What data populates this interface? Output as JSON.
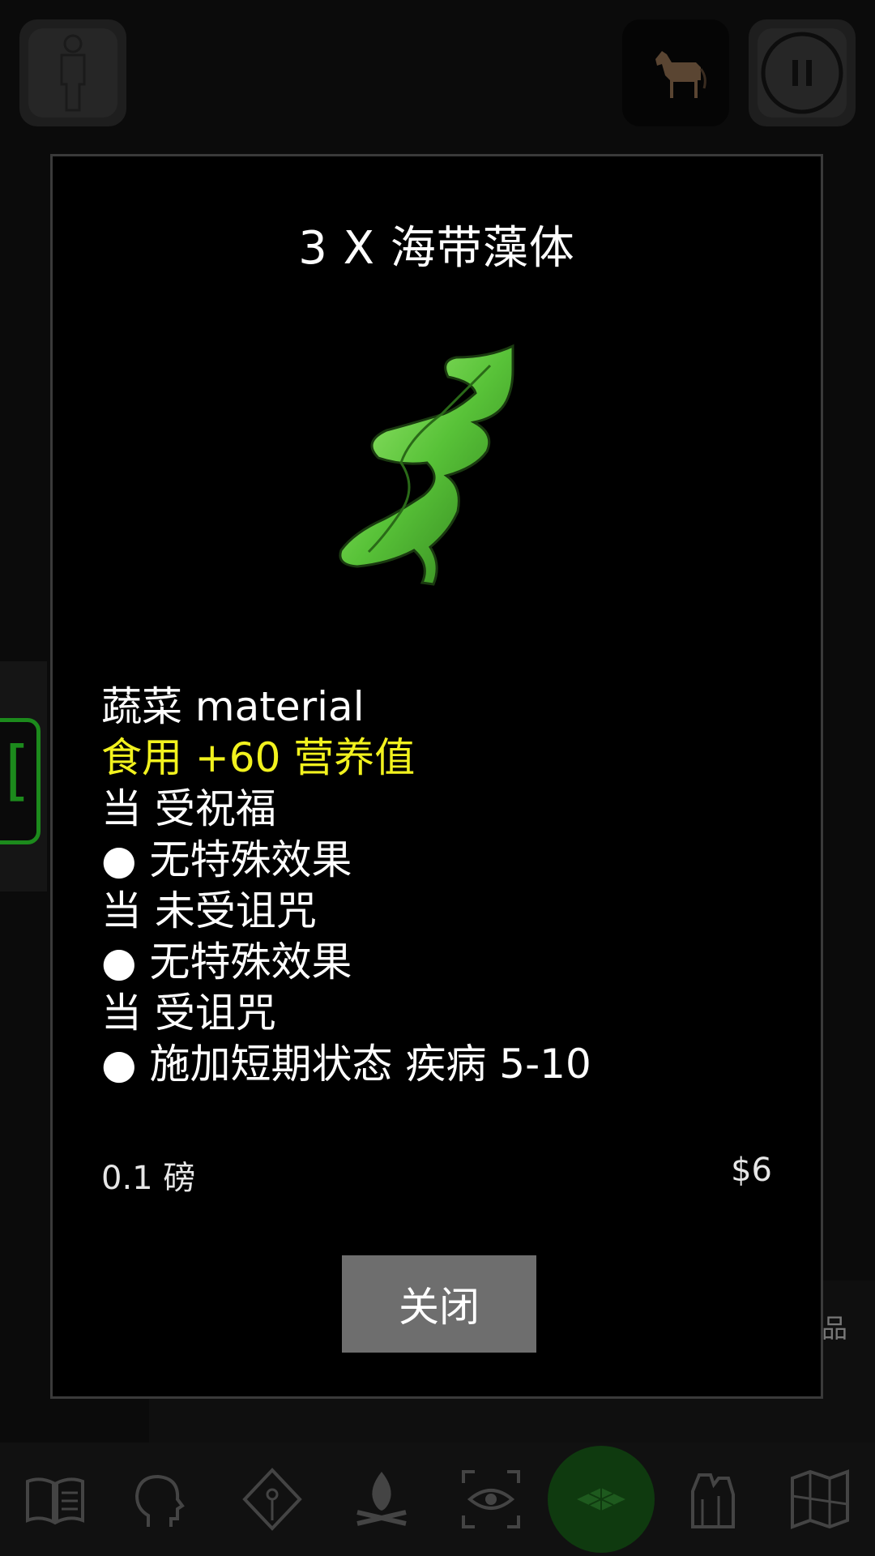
{
  "dialog": {
    "title": "3 X 海带藻体",
    "item_image": "kelp-icon",
    "type_line": "蔬菜 material",
    "food_line": "食用 +60 营养值",
    "effects": [
      "当 受祝福",
      "● 无特殊效果",
      "当 未受诅咒",
      "● 无特殊效果",
      "当 受诅咒",
      "● 施加短期状态 疾病 5-10"
    ],
    "weight": "0.1 磅",
    "price": "$6",
    "close_label": "关闭"
  },
  "background": {
    "right_label_fragment": "品"
  },
  "top_bar": {
    "character_icon": "person-icon",
    "mount_icon": "horse-icon",
    "pause_icon": "pause-icon"
  },
  "bottom_nav": [
    {
      "icon": "journal-icon",
      "active": false
    },
    {
      "icon": "head-icon",
      "active": false
    },
    {
      "icon": "skills-icon",
      "active": false
    },
    {
      "icon": "campfire-icon",
      "active": false
    },
    {
      "icon": "look-icon",
      "active": false
    },
    {
      "icon": "ground-icon",
      "active": true
    },
    {
      "icon": "inventory-icon",
      "active": false
    },
    {
      "icon": "map-icon",
      "active": false
    }
  ],
  "colors": {
    "food_text": "#f2f21e",
    "active_nav": "#0f3a0f",
    "accent_green": "#1c8a1c",
    "close_button": "#6e6e6e"
  }
}
